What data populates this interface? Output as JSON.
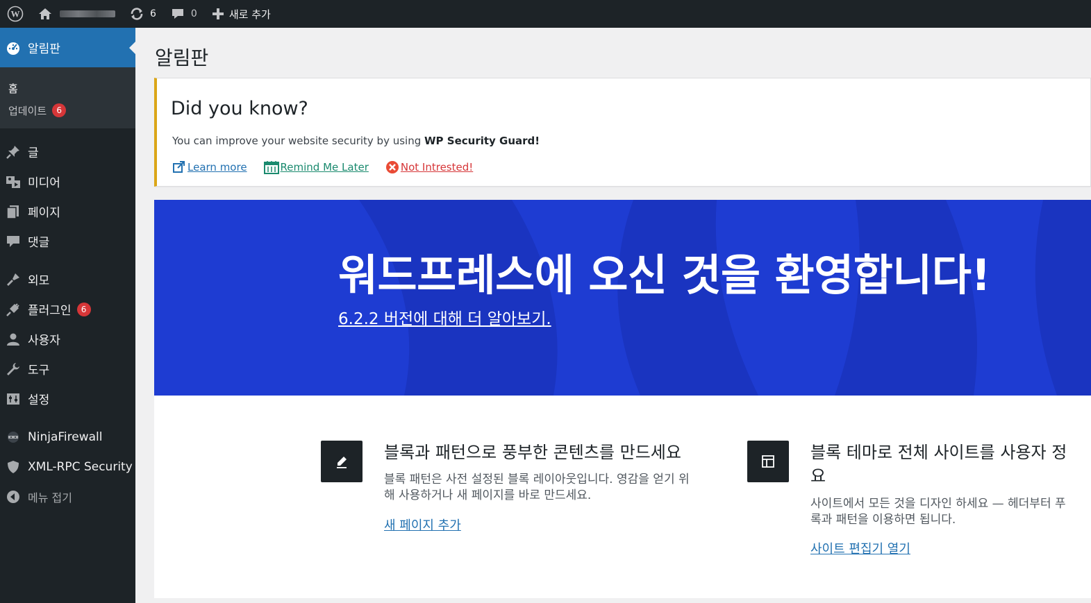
{
  "adminbar": {
    "updates_count": "6",
    "comments_count": "0",
    "new_label": "새로 추가"
  },
  "sidebar": {
    "current": "알림판",
    "sub": [
      "홈",
      "업데이트"
    ],
    "updates_badge": "6",
    "items": [
      "글",
      "미디어",
      "페이지",
      "댓글",
      "외모",
      "플러그인",
      "사용자",
      "도구",
      "설정",
      "NinjaFirewall",
      "XML-RPC Security",
      "메뉴 접기"
    ],
    "plugins_badge": "6"
  },
  "main": {
    "title": "알림판",
    "notice": {
      "heading": "Did you know?",
      "text_prefix": "You can improve your website security by using ",
      "text_bold": "WP Security Guard!",
      "learn_more": "Learn more",
      "remind_later": "Remind Me Later",
      "not_interested": "Not Intrested!"
    },
    "welcome": {
      "heading": "워드프레스에 오신 것을 환영합니다!",
      "version_link": "6.2.2 버전에 대해 더 알아보기."
    },
    "panels": [
      {
        "title": "블록과 패턴으로 풍부한 콘텐츠를 만드세요",
        "desc1": "블록 패턴은 사전 설정된 블록 레이아웃입니다. 영감을 얻기 위",
        "desc2": "해 사용하거나 새 페이지를 바로 만드세요.",
        "link": "새 페이지 추가"
      },
      {
        "title1": "블록 테마로 전체 사이트를 사용자 정",
        "title2": "요",
        "desc1": "사이트에서 모든 것을 디자인 하세요 — 헤더부터 푸",
        "desc2": "록과 패턴을 이용하면 됩니다.",
        "link": "사이트 편집기 열기"
      }
    ]
  },
  "colors": {
    "adminbar": "#1d2327",
    "accent": "#2271b1",
    "welcome_bg": "#1e3cd2",
    "badge": "#d63638",
    "notice_border": "#dba617"
  }
}
